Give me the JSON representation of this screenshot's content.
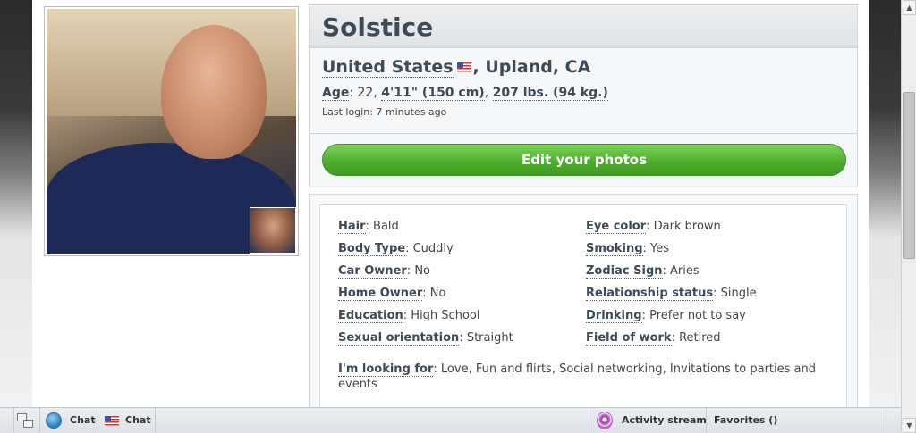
{
  "profile": {
    "name": "Solstice",
    "location": {
      "country": "United States",
      "city_state": ", Upland, CA"
    },
    "stats": {
      "age_label": "Age",
      "age_value": ": 22, ",
      "height": "4'11\" (150 cm)",
      "separator": ", ",
      "weight": "207 lbs. (94 kg.)"
    },
    "last_login": "Last login: 7 minutes ago",
    "edit_photos_label": "Edit your photos"
  },
  "details": {
    "left": [
      {
        "key": "Hair",
        "value": "Bald"
      },
      {
        "key": "Body Type",
        "value": "Cuddly"
      },
      {
        "key": "Car Owner",
        "value": "No"
      },
      {
        "key": "Home Owner",
        "value": "No"
      },
      {
        "key": "Education",
        "value": "High School"
      },
      {
        "key": "Sexual orientation",
        "value": "Straight"
      }
    ],
    "right": [
      {
        "key": "Eye color",
        "value": "Dark brown"
      },
      {
        "key": "Smoking",
        "value": "Yes"
      },
      {
        "key": "Zodiac Sign",
        "value": "Aries"
      },
      {
        "key": "Relationship status",
        "value": "Single"
      },
      {
        "key": "Drinking",
        "value": "Prefer not to say"
      },
      {
        "key": "Field of work",
        "value": "Retired"
      }
    ],
    "looking_for": {
      "key": "I'm looking for",
      "value": "Love, Fun and flirts, Social networking, Invitations to parties and events"
    }
  },
  "bottom_bar": {
    "chat_global_label": "Chat",
    "chat_us_label": "Chat",
    "activity_stream_label": "Activity stream",
    "favorites_label": "Favorites ()"
  },
  "icons": {
    "flag": "us-flag-icon",
    "windows": "windows-icon",
    "globe": "globe-icon",
    "activity": "podcast-icon"
  },
  "colors": {
    "edit_button": "#4fae2e",
    "heading": "#3e4a55"
  }
}
